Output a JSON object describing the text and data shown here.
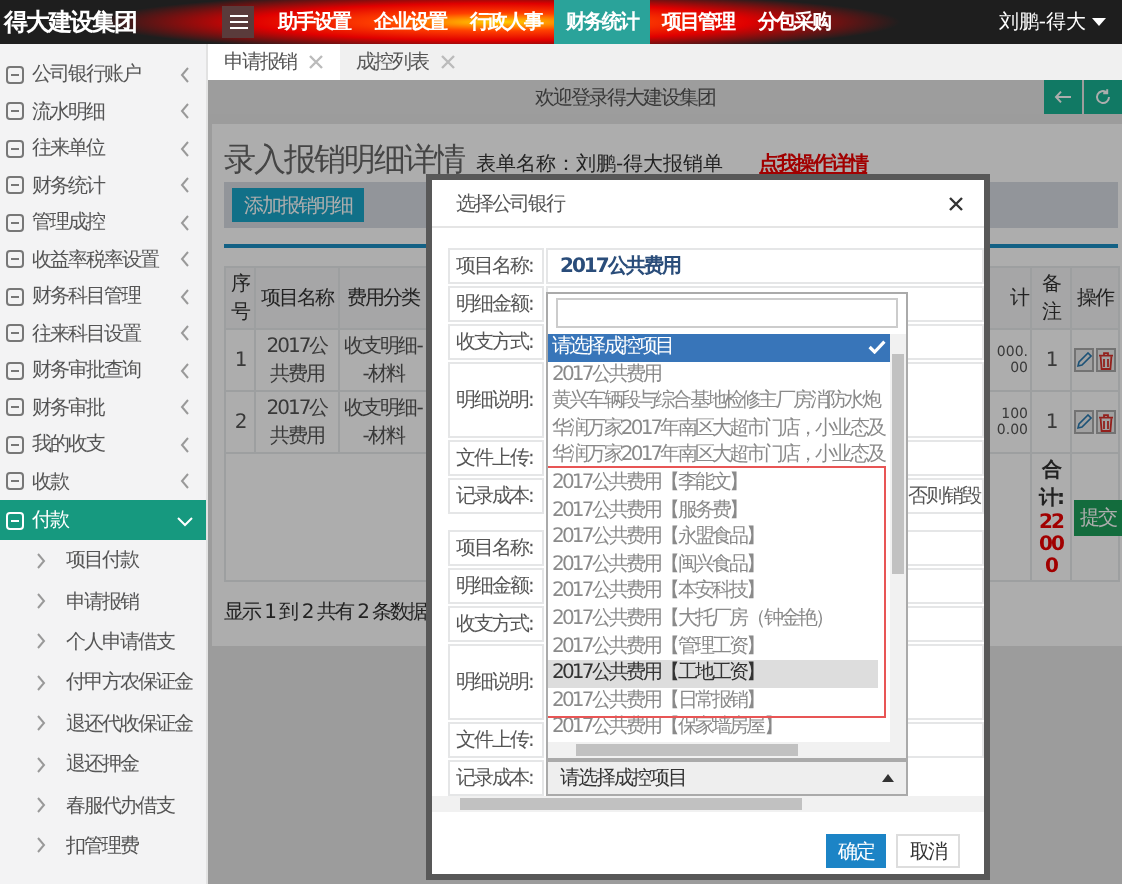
{
  "header": {
    "logo": "得大建设集团",
    "nav": [
      {
        "label": "助手设置",
        "selected": false
      },
      {
        "label": "企业设置",
        "selected": false
      },
      {
        "label": "行政人事",
        "selected": false
      },
      {
        "label": "财务统计",
        "selected": true
      },
      {
        "label": "项目管理",
        "selected": false
      },
      {
        "label": "分包采购",
        "selected": false
      }
    ],
    "user": "刘鹏-得大"
  },
  "sidebar": {
    "items": [
      {
        "label": "公司银行账户",
        "selected": false,
        "expanded": false
      },
      {
        "label": "流水明细",
        "selected": false,
        "expanded": false
      },
      {
        "label": "往来单位",
        "selected": false,
        "expanded": false
      },
      {
        "label": "财务统计",
        "selected": false,
        "expanded": false
      },
      {
        "label": "管理成控",
        "selected": false,
        "expanded": false
      },
      {
        "label": "收益率税率设置",
        "selected": false,
        "expanded": false
      },
      {
        "label": "财务科目管理",
        "selected": false,
        "expanded": false
      },
      {
        "label": "往来科目设置",
        "selected": false,
        "expanded": false
      },
      {
        "label": "财务审批查询",
        "selected": false,
        "expanded": false
      },
      {
        "label": "财务审批",
        "selected": false,
        "expanded": false
      },
      {
        "label": "我的收支",
        "selected": false,
        "expanded": false
      },
      {
        "label": "收款",
        "selected": false,
        "expanded": false
      },
      {
        "label": "付款",
        "selected": true,
        "expanded": true,
        "children": [
          {
            "label": "项目付款",
            "selected": false
          },
          {
            "label": "申请报销",
            "selected": false
          },
          {
            "label": "个人申请借支",
            "selected": false
          },
          {
            "label": "付甲方农保证金",
            "selected": false
          },
          {
            "label": "退还代收保证金",
            "selected": false
          },
          {
            "label": "退还押金",
            "selected": false
          },
          {
            "label": "春服代办借支",
            "selected": false
          },
          {
            "label": "扣管理费",
            "selected": false
          }
        ]
      }
    ]
  },
  "tabs": [
    {
      "label": "申请报销",
      "selected": true
    },
    {
      "label": "成控列表",
      "selected": false
    }
  ],
  "welcome": "欢迎登录得大建设集团",
  "page": {
    "title": "录入报销明细详情",
    "form_name": "表单名称：刘鹏-得大报销单",
    "detail_link": "点我操作详情",
    "add_button": "添加报销明细",
    "table": {
      "columns": [
        "序号",
        "项目名称",
        "费用分类",
        "计",
        "备注",
        "操作"
      ],
      "rows": [
        {
          "cells": [
            "1",
            "2017公共费用",
            "收支明细--材料",
            "000.00",
            "1"
          ]
        },
        {
          "cells": [
            "2",
            "2017公共费用",
            "收支明细--材料",
            "1000.00",
            "1"
          ]
        }
      ],
      "total_label": "合计:",
      "total_value": "22000",
      "submit": "提交"
    },
    "pager": "显示 1 到 2 共有 2 条数据"
  },
  "dialog": {
    "title": "选择公司银行",
    "groups": [
      {
        "fields": [
          {
            "label": "项目名称:",
            "kind": "value",
            "value": "2017公共费用"
          },
          {
            "label": "明细金额:",
            "kind": "blank"
          },
          {
            "label": "收支方式:",
            "kind": "blank"
          },
          {
            "label": "明细说明:",
            "kind": "textarea"
          },
          {
            "label": "文件上传:",
            "kind": "blank"
          },
          {
            "label": "记录成本:",
            "kind": "note",
            "value": "否则销毁"
          }
        ]
      },
      {
        "fields": [
          {
            "label": "项目名称:",
            "kind": "blank"
          },
          {
            "label": "明细金额:",
            "kind": "blank"
          },
          {
            "label": "收支方式:",
            "kind": "blank"
          },
          {
            "label": "明细说明:",
            "kind": "textarea"
          },
          {
            "label": "文件上传:",
            "kind": "blank"
          },
          {
            "label": "记录成本:",
            "kind": "select",
            "value": "请选择成控项目",
            "expanded": true
          }
        ]
      }
    ],
    "dropdown": {
      "groups": [
        {
          "marked": false,
          "options": [
            {
              "label": "请选择成控项目",
              "selected": true,
              "highlighted": false
            },
            {
              "label": "2017公共费用",
              "selected": false,
              "highlighted": false
            },
            {
              "label": "黄兴车辆段与综合基地检修主厂房消防水炮",
              "selected": false,
              "highlighted": false
            },
            {
              "label": "华润万家2017年南区大超市门店，小业态及",
              "selected": false,
              "highlighted": false
            },
            {
              "label": "华润万家2017年南区大超市门店，小业态及",
              "selected": false,
              "highlighted": false
            }
          ]
        },
        {
          "marked": true,
          "options": [
            {
              "label": "2017公共费用【李能文】",
              "selected": false,
              "highlighted": false
            },
            {
              "label": "2017公共费用【服务费】",
              "selected": false,
              "highlighted": false
            },
            {
              "label": "2017公共费用【永盟食品】",
              "selected": false,
              "highlighted": false
            },
            {
              "label": "2017公共费用【闽兴食品】",
              "selected": false,
              "highlighted": false
            },
            {
              "label": "2017公共费用【本安科技】",
              "selected": false,
              "highlighted": false
            },
            {
              "label": "2017公共费用【大托厂房（钟金艳）",
              "selected": false,
              "highlighted": false
            },
            {
              "label": "2017公共费用【管理工资】",
              "selected": false,
              "highlighted": false
            },
            {
              "label": "2017公共费用【工地工资】",
              "selected": false,
              "highlighted": true
            },
            {
              "label": "2017公共费用【日常报销】",
              "selected": false,
              "highlighted": false
            }
          ]
        },
        {
          "marked": false,
          "options": [
            {
              "label": "2017公共费用【保家墙房屋】",
              "selected": false,
              "highlighted": false
            }
          ]
        }
      ]
    },
    "buttons": [
      {
        "label": "确定",
        "kind": "primary"
      },
      {
        "label": "取消",
        "kind": "default"
      }
    ]
  }
}
